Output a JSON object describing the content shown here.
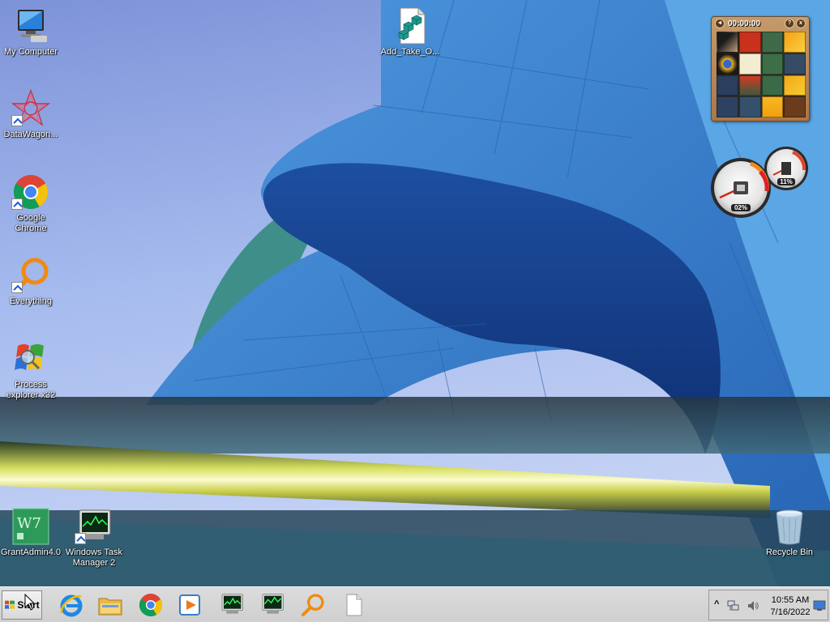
{
  "desktop": {
    "icons": [
      {
        "label": "My Computer"
      },
      {
        "label": "DataWagon..."
      },
      {
        "label": "Google Chrome"
      },
      {
        "label": "Everything"
      },
      {
        "label": "Process\nexplorer x32"
      },
      {
        "label": "Add_Take_O..."
      },
      {
        "label": "GrantAdmin4.0"
      },
      {
        "label": "Windows Task\nManager 2"
      },
      {
        "label": "Recycle Bin"
      }
    ]
  },
  "gadgets": {
    "puzzle": {
      "timer": "00:00:00",
      "help_label": "?",
      "close_label": "x"
    },
    "meter": {
      "cpu_percent": "02%",
      "memory_percent": "11%"
    }
  },
  "taskbar": {
    "start_label": "Start",
    "pinned": [
      {
        "icon": "internet-explorer-icon"
      },
      {
        "icon": "file-explorer-icon"
      },
      {
        "icon": "chrome-icon"
      },
      {
        "icon": "media-player-icon"
      },
      {
        "icon": "task-manager-icon"
      },
      {
        "icon": "task-manager-2-icon"
      },
      {
        "icon": "everything-icon"
      },
      {
        "icon": "blank-document-icon"
      }
    ],
    "tray": {
      "overflow_label": "^",
      "time": "10:55 AM",
      "date": "7/16/2022"
    }
  },
  "colors": {
    "taskbar_bg": "#d4d4d4",
    "label_text": "#ffffff",
    "sky": "#8fa8e6",
    "building_blue": "#2f78c8"
  }
}
